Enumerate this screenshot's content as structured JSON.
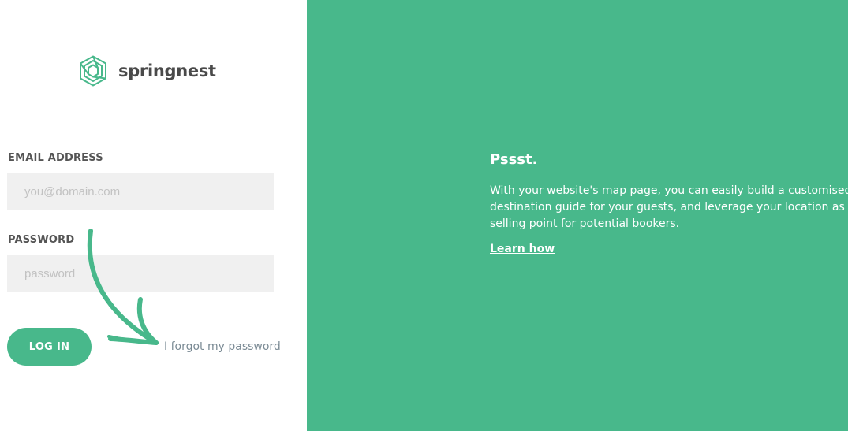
{
  "brand": {
    "name": "springnest",
    "logo_icon": "hexagon-logo-icon",
    "accent_color": "#48b88b"
  },
  "login_form": {
    "email_label": "EMAIL ADDRESS",
    "email_placeholder": "you@domain.com",
    "email_value": "",
    "password_label": "PASSWORD",
    "password_placeholder": "password",
    "password_value": "",
    "login_button": "LOG IN",
    "forgot_link": "I forgot my password",
    "hint_icon": "curved-arrow-icon"
  },
  "promo": {
    "title": "Pssst.",
    "body": "With your website's map page, you can easily build a customised destination guide for your guests, and leverage your location as a selling point for potential bookers.",
    "link": "Learn how",
    "background_color": "#48b88b"
  }
}
